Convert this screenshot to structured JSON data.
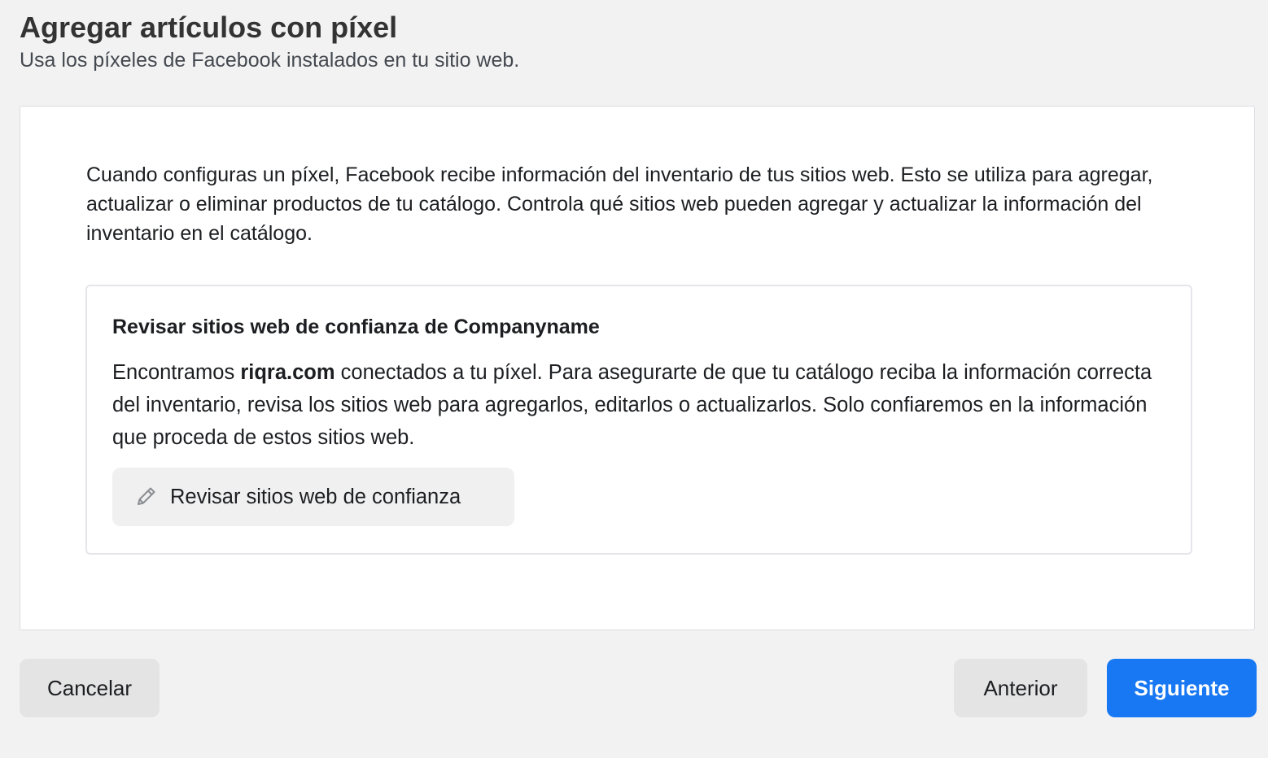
{
  "header": {
    "title": "Agregar artículos con píxel",
    "subtitle": "Usa los píxeles de Facebook instalados en tu sitio web."
  },
  "card": {
    "intro": "Cuando configuras un píxel, Facebook recibe información del inventario de tus sitios web. Esto se utiliza para agregar, actualizar o eliminar productos de tu catálogo. Controla qué sitios web pueden agregar y actualizar la información del inventario en el catálogo.",
    "review": {
      "title": "Revisar sitios web de confianza de Companyname",
      "text_before": "Encontramos ",
      "domain": "riqra.com",
      "text_after": " conectados a tu píxel. Para asegurarte de que tu catálogo reciba la información correcta del inventario, revisa los sitios web para agregarlos, editarlos o actualizarlos. Solo confiaremos en la información que proceda de estos sitios web.",
      "button_label": "Revisar sitios web de confianza",
      "button_icon": "pencil-icon"
    }
  },
  "footer": {
    "cancel_label": "Cancelar",
    "previous_label": "Anterior",
    "next_label": "Siguiente"
  },
  "colors": {
    "primary": "#1877f2",
    "background": "#f2f2f2",
    "secondary_button": "#e4e4e4"
  }
}
